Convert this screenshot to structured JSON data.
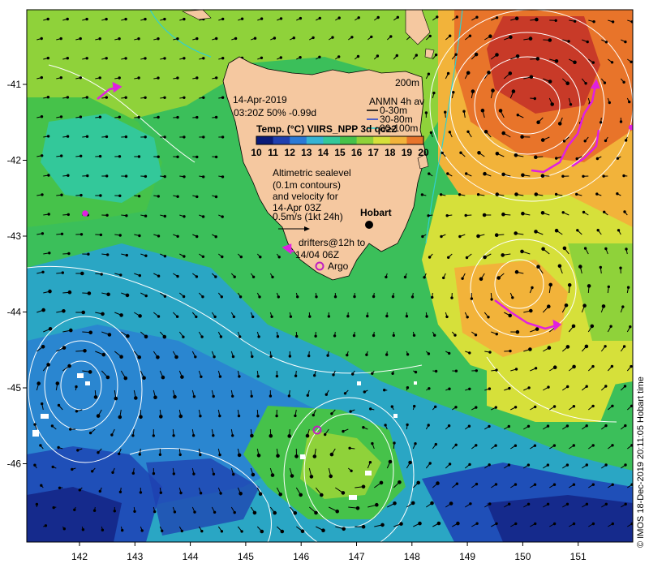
{
  "map": {
    "date_label": "14-Apr-2019",
    "time_label": "03:20Z  50% -0.99d",
    "depth_label": "200m",
    "temp_title": "Temp. (°C) VIIRS_NPP 3d qc≥2",
    "colorbar_ticks": [
      "10",
      "11",
      "12",
      "13",
      "14",
      "15",
      "16",
      "17",
      "18",
      "19",
      "20"
    ],
    "colorbar_colors": [
      "#0a1a78",
      "#1f3fb0",
      "#2b7ad6",
      "#36b4d4",
      "#33c89a",
      "#46c24a",
      "#8fd23a",
      "#d6e03a",
      "#f2b33a",
      "#e8742a",
      "#c83a28"
    ],
    "anmn": {
      "title": "ANMN 4h av",
      "items": [
        {
          "label": "0-30m",
          "color": "#000000"
        },
        {
          "label": "30-80m",
          "color": "#1a3fd6"
        },
        {
          "label": "80-100m",
          "color": "#19d6d6"
        }
      ]
    },
    "altimetry_text": [
      "Altimetric sealevel",
      "(0.1m contours)",
      "and velocity for",
      "14-Apr 03Z",
      "0.5m/s (1kt 24h)"
    ],
    "city_label": "Hobart",
    "drifters_text": [
      "drifters@12h to",
      "14/04 06Z"
    ],
    "argo_label": "Argo",
    "lon_ticks": [
      "142",
      "143",
      "144",
      "145",
      "146",
      "147",
      "148",
      "149",
      "150",
      "151"
    ],
    "lat_ticks": [
      "-41",
      "-42",
      "-43",
      "-44",
      "-45",
      "-46"
    ],
    "credit": "© IMOS 18-Dec-2019 20:11:05 Hobart time",
    "colors": {
      "land": "#f5c8a0",
      "argo": "#c020c0",
      "drifter": "#e020e0",
      "shelf_edge": "#30d0d0",
      "contours": "#ffffff"
    }
  }
}
